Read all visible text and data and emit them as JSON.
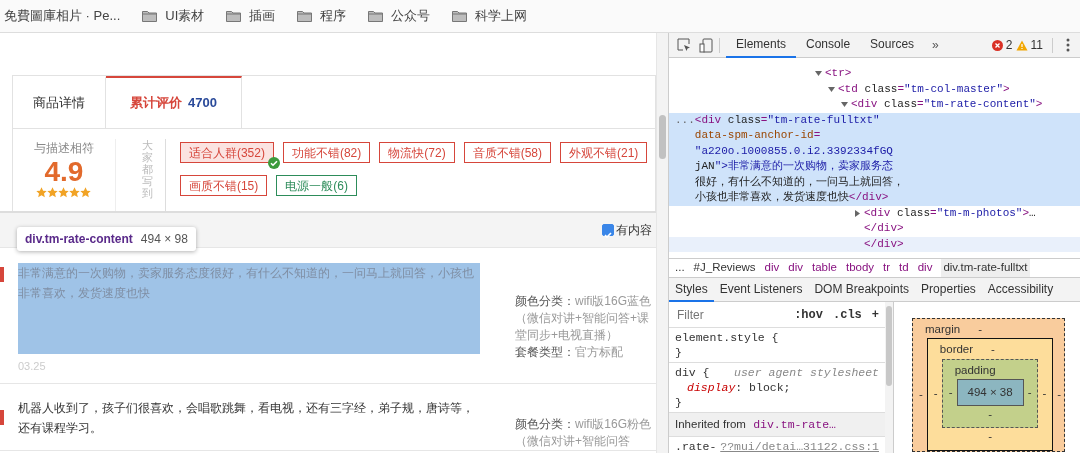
{
  "bookmarks": [
    {
      "label": "免費圖庫相片 · Pe...",
      "kind": "page"
    },
    {
      "label": "UI素材",
      "kind": "folder"
    },
    {
      "label": "插画",
      "kind": "folder"
    },
    {
      "label": "程序",
      "kind": "folder"
    },
    {
      "label": "公众号",
      "kind": "folder"
    },
    {
      "label": "科学上网",
      "kind": "folder"
    }
  ],
  "page": {
    "tabs": [
      {
        "label": "商品详情",
        "selected": false
      },
      {
        "label": "累计评价",
        "count": "4700",
        "selected": true
      }
    ],
    "rating": {
      "label": "与描述相符",
      "score": "4.9",
      "stars": 5
    },
    "tags_heading": "大家都写到",
    "tags": [
      {
        "label": "适合人群(352)",
        "selected": true,
        "color": "#d6463b"
      },
      {
        "label": "功能不错(82)",
        "selected": false,
        "color": "#d6463b"
      },
      {
        "label": "物流快(72)",
        "selected": false,
        "color": "#d6463b"
      },
      {
        "label": "音质不错(58)",
        "selected": false,
        "color": "#d6463b"
      },
      {
        "label": "外观不错(21)",
        "selected": false,
        "color": "#d6463b"
      },
      {
        "label": "画质不错(15)",
        "selected": false,
        "color": "#d6463b"
      },
      {
        "label": "电源一般(6)",
        "selected": false,
        "color": "#2d8c5a"
      }
    ],
    "content_filter": {
      "label": "有内容",
      "checked": true
    },
    "inspect_tooltip": {
      "selector": "div.tm-rate-content",
      "size": "494 × 98"
    },
    "reviews": [
      {
        "text": "非常满意的一次购物，卖家服务态度很好，有什么不知道的，一问马上就回答，小孩也非常喜欢，发货速度也快",
        "highlighted": true,
        "date": "03.25",
        "meta": [
          {
            "label": "颜色分类：",
            "value": "wifi版16G蓝色（微信对讲+智能问答+课堂同步+电视直播）"
          },
          {
            "label": "套餐类型：",
            "value": "官方标配"
          }
        ]
      },
      {
        "text": "机器人收到了，孩子们很喜欢，会唱歌跳舞，看电视，还有三字经，弟子规，唐诗等，还有课程学习。",
        "highlighted": false,
        "meta": [
          {
            "label": "颜色分类：",
            "value": "wifi版16G粉色（微信对讲+智能问答"
          }
        ]
      }
    ]
  },
  "devtools": {
    "tabs": [
      {
        "label": "Elements",
        "selected": true
      },
      {
        "label": "Console",
        "selected": false
      },
      {
        "label": "Sources",
        "selected": false
      }
    ],
    "more": "»",
    "errors": "2",
    "warnings": "11",
    "dom_tree": [
      {
        "kind": "element",
        "tag": "<tr>",
        "expanded": true,
        "children": [
          {
            "kind": "element",
            "tag": "<td class=\"tm-col-master\">",
            "expanded": true,
            "children": [
              {
                "kind": "element",
                "tag": "<div class=\"tm-rate-content\">",
                "expanded": true,
                "children": [
                  {
                    "kind": "text",
                    "gutter": "...",
                    "selected": true,
                    "lines": [
                      "<div class=\"tm-rate-fulltxt\"",
                      "data-spm-anchor-id=",
                      "\"a220o.1000855.0.i2.3392334fGQ",
                      "jAN\">非常满意的一次购物，卖家服务态",
                      "很好，有什么不知道的，一问马上就回答，",
                      "小孩也非常喜欢，发货速度也快</div>"
                    ]
                  },
                  {
                    "kind": "element",
                    "tag": "<div class=\"tm-m-photos\">…",
                    "expanded": false
                  },
                  {
                    "kind": "closing",
                    "tag": "</div>",
                    "hovered": false
                  },
                  {
                    "kind": "closing",
                    "tag": "</div>",
                    "hovered": true
                  }
                ]
              }
            ]
          }
        ]
      }
    ],
    "breadcrumbs": [
      {
        "label": "...",
        "selected": false
      },
      {
        "label": "#J_Reviews",
        "selected": false
      },
      {
        "label": "div",
        "selected": false
      },
      {
        "label": "div",
        "selected": false
      },
      {
        "label": "table",
        "selected": false
      },
      {
        "label": "tbody",
        "selected": false
      },
      {
        "label": "tr",
        "selected": false
      },
      {
        "label": "td",
        "selected": false
      },
      {
        "label": "div",
        "selected": false
      },
      {
        "label": "div.tm-rate-fulltxt",
        "selected": true
      }
    ],
    "panel_tabs": [
      {
        "label": "Styles",
        "selected": true
      },
      {
        "label": "Event Listeners",
        "selected": false
      },
      {
        "label": "DOM Breakpoints",
        "selected": false
      },
      {
        "label": "Properties",
        "selected": false
      },
      {
        "label": "Accessibility",
        "selected": false
      }
    ],
    "styles": {
      "filter_placeholder": "Filter",
      "hov": ":hov",
      "cls": ".cls",
      "add": "+",
      "rules": [
        {
          "kind": "rule",
          "selector": "element.style {",
          "close": "}"
        },
        {
          "kind": "rule",
          "selector": "div {",
          "source": "user agent stylesheet",
          "declarations": [
            {
              "property": "display",
              "separator": ":",
              "value": "block;"
            }
          ],
          "close": "}"
        },
        {
          "kind": "inherited",
          "label": "Inherited from",
          "selector": "div.tm-rate…"
        },
        {
          "kind": "rule",
          "selector": ".rate-",
          "source": "??mui/detai…31122.css:1"
        }
      ]
    },
    "box_model": {
      "layers": [
        {
          "name": "margin",
          "top": "-",
          "left": "-",
          "right": "-"
        },
        {
          "name": "border",
          "top": "-",
          "left": "-",
          "right": "-"
        },
        {
          "name": "padding",
          "left": "-",
          "right": "-"
        }
      ],
      "bottoms": [
        "-",
        "-"
      ],
      "content": "494 × 38"
    }
  }
}
